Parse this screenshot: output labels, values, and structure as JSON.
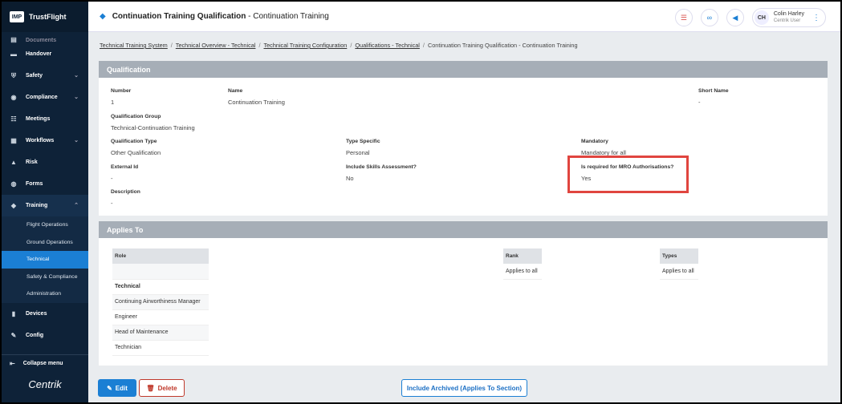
{
  "brand": {
    "logo": "IMP",
    "name": "TrustFlight",
    "footer": "Centrik"
  },
  "sidebar": {
    "cut_item": "Documents",
    "items": [
      {
        "label": "Handover",
        "icon": "handover-icon",
        "chevron": ""
      },
      {
        "label": "Safety",
        "icon": "shield-icon",
        "chevron": "⌄"
      },
      {
        "label": "Compliance",
        "icon": "compliance-icon",
        "chevron": "⌄"
      },
      {
        "label": "Meetings",
        "icon": "meetings-icon",
        "chevron": ""
      },
      {
        "label": "Workflows",
        "icon": "workflows-icon",
        "chevron": "⌄"
      },
      {
        "label": "Risk",
        "icon": "risk-icon",
        "chevron": ""
      },
      {
        "label": "Forms",
        "icon": "forms-icon",
        "chevron": ""
      },
      {
        "label": "Training",
        "icon": "training-icon",
        "chevron": "⌃"
      }
    ],
    "training_sub": [
      "Flight Operations",
      "Ground Operations",
      "Technical",
      "Safety & Compliance",
      "Administration"
    ],
    "bottom_items": [
      {
        "label": "Devices",
        "icon": "devices-icon"
      },
      {
        "label": "Config",
        "icon": "config-icon"
      }
    ],
    "collapse_label": "Collapse menu"
  },
  "header": {
    "title_main": "Continuation Training Qualification",
    "title_sub": "- Continuation Training",
    "user_initials": "CH",
    "user_name": "Colin Harley",
    "user_role": "Centrik User"
  },
  "breadcrumb": {
    "links": [
      "Technical Training System",
      "Technical Overview - Technical",
      "Technical Training Configuration",
      "Qualifications - Technical"
    ],
    "current": "Continuation Training Qualification - Continuation Training"
  },
  "qualification": {
    "heading": "Qualification",
    "number_label": "Number",
    "number": "1",
    "name_label": "Name",
    "name": "Continuation Training",
    "short_name_label": "Short Name",
    "short_name": "-",
    "group_label": "Qualification Group",
    "group": "Technical-Continuation Training",
    "type_label": "Qualification Type",
    "type": "Other Qualification",
    "type_specific_label": "Type Specific",
    "type_specific": "Personal",
    "mandatory_label": "Mandatory",
    "mandatory": "Mandatory for all",
    "external_id_label": "External Id",
    "external_id": "-",
    "skills_label": "Include Skills Assessment?",
    "skills": "No",
    "mro_label": "Is required for MRO Authorisations?",
    "mro": "Yes",
    "description_label": "Description",
    "description": "-"
  },
  "applies_to": {
    "heading": "Applies To",
    "role_header": "Role",
    "roles": [
      "Technical",
      "Continuing Airworthiness Manager",
      "Engineer",
      "Head of Maintenance",
      "Technician"
    ],
    "rank_header": "Rank",
    "rank_value": "Applies to all",
    "types_header": "Types",
    "types_value": "Applies to all"
  },
  "actions": {
    "edit": "Edit",
    "delete": "Delete",
    "include_archived": "Include Archived (Applies To Section)"
  },
  "colors": {
    "accent": "#1b7fd4",
    "sidebar": "#0e2238",
    "highlight": "#e0453f",
    "danger": "#c0392b"
  }
}
